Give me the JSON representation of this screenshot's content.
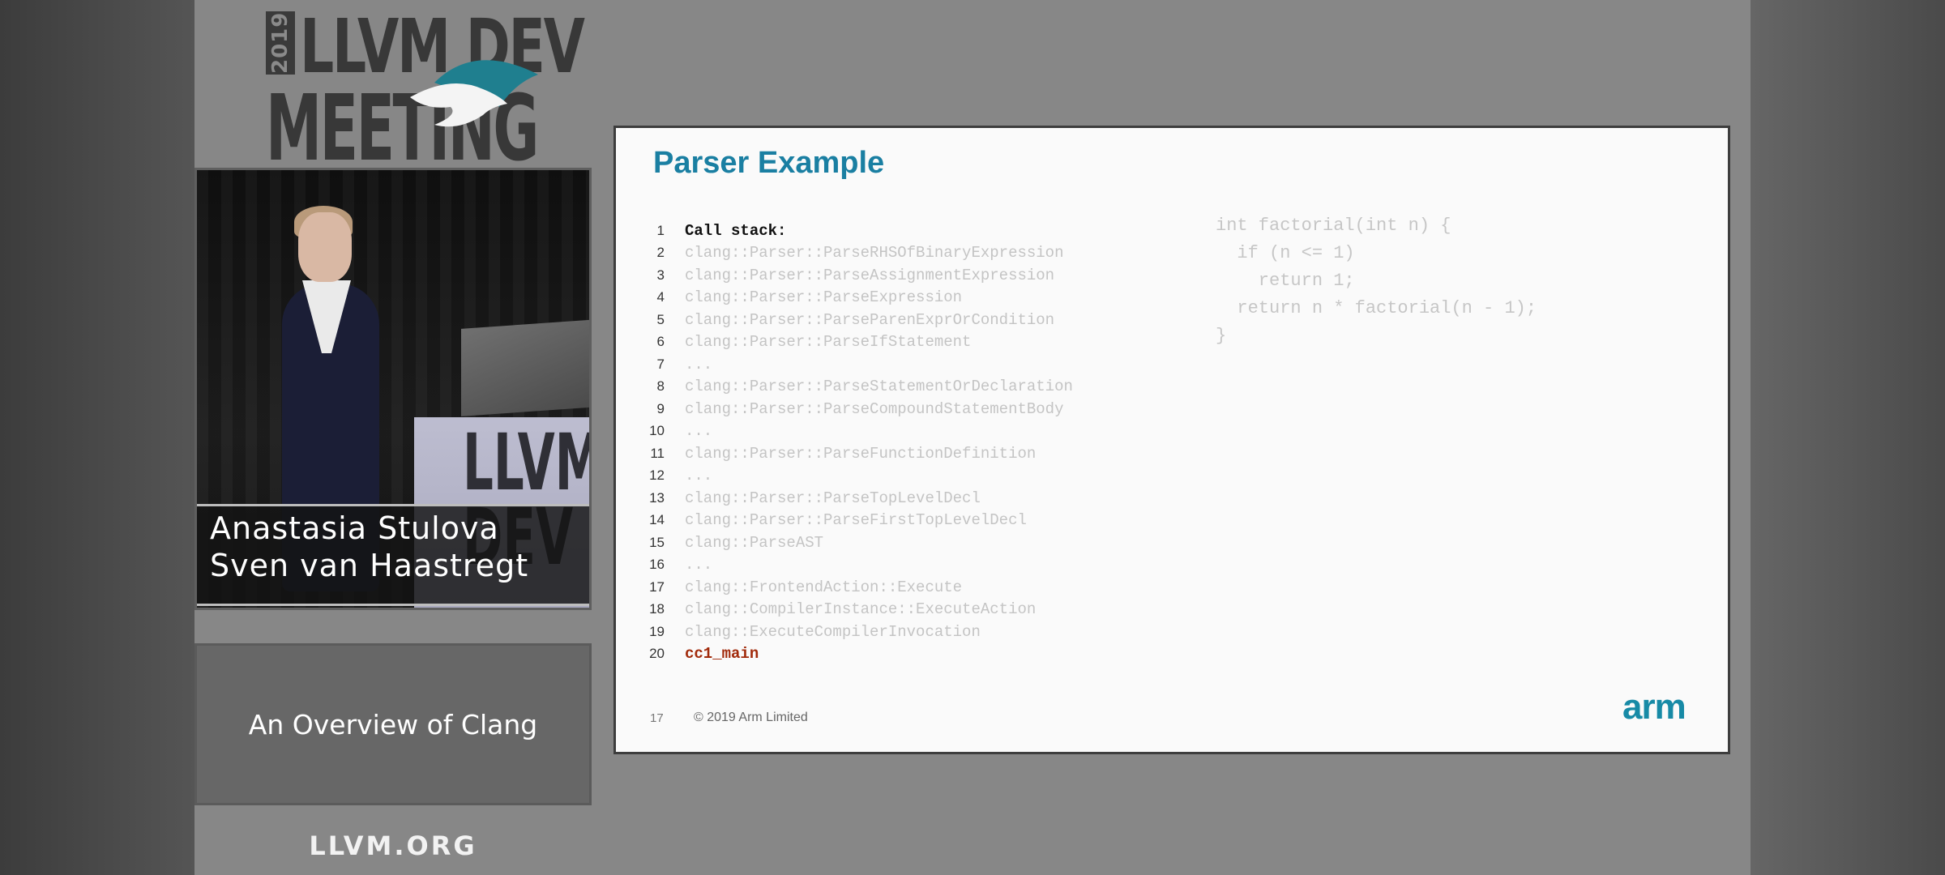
{
  "logo": {
    "year": "2019",
    "line1": "LLVM DEV",
    "line2": "MEETING"
  },
  "video": {
    "speakers": [
      "Anastasia Stulova",
      "Sven van Haastregt"
    ],
    "podium_text": "LLVM\nDEV"
  },
  "talk": {
    "title": "An Overview of Clang",
    "site": "LLVM.ORG"
  },
  "slide": {
    "title": "Parser Example",
    "code_lines": [
      {
        "n": "1",
        "text": "Call stack:",
        "style": "header"
      },
      {
        "n": "2",
        "text": "clang::Parser::ParseRHSOfBinaryExpression",
        "style": "dim"
      },
      {
        "n": "3",
        "text": "clang::Parser::ParseAssignmentExpression",
        "style": "dim"
      },
      {
        "n": "4",
        "text": "clang::Parser::ParseExpression",
        "style": "dim"
      },
      {
        "n": "5",
        "text": "clang::Parser::ParseParenExprOrCondition",
        "style": "dim"
      },
      {
        "n": "6",
        "text": "clang::Parser::ParseIfStatement",
        "style": "dim"
      },
      {
        "n": "7",
        "text": "...",
        "style": "dim"
      },
      {
        "n": "8",
        "text": "clang::Parser::ParseStatementOrDeclaration",
        "style": "dim"
      },
      {
        "n": "9",
        "text": "clang::Parser::ParseCompoundStatementBody",
        "style": "dim"
      },
      {
        "n": "10",
        "text": "...",
        "style": "dim"
      },
      {
        "n": "11",
        "text": "clang::Parser::ParseFunctionDefinition",
        "style": "dim"
      },
      {
        "n": "12",
        "text": "...",
        "style": "dim"
      },
      {
        "n": "13",
        "text": "clang::Parser::ParseTopLevelDecl",
        "style": "dim"
      },
      {
        "n": "14",
        "text": "clang::Parser::ParseFirstTopLevelDecl",
        "style": "dim"
      },
      {
        "n": "15",
        "text": "clang::ParseAST",
        "style": "dim"
      },
      {
        "n": "16",
        "text": "...",
        "style": "dim"
      },
      {
        "n": "17",
        "text": "clang::FrontendAction::Execute",
        "style": "dim"
      },
      {
        "n": "18",
        "text": "clang::CompilerInstance::ExecuteAction",
        "style": "dim"
      },
      {
        "n": "19",
        "text": "clang::ExecuteCompilerInvocation",
        "style": "dim"
      },
      {
        "n": "20",
        "text": "cc1_main",
        "style": "active"
      }
    ],
    "source_code": [
      "int factorial(int n) {",
      "  if (n <= 1)",
      "    return 1;",
      "  return n * factorial(n - 1);",
      "}"
    ],
    "slide_number": "17",
    "copyright": "© 2019 Arm Limited",
    "brand": "arm"
  },
  "colors": {
    "slide_title": "#1a7fa2",
    "active_line": "#a12a0b",
    "arm_brand": "#178aa6"
  }
}
